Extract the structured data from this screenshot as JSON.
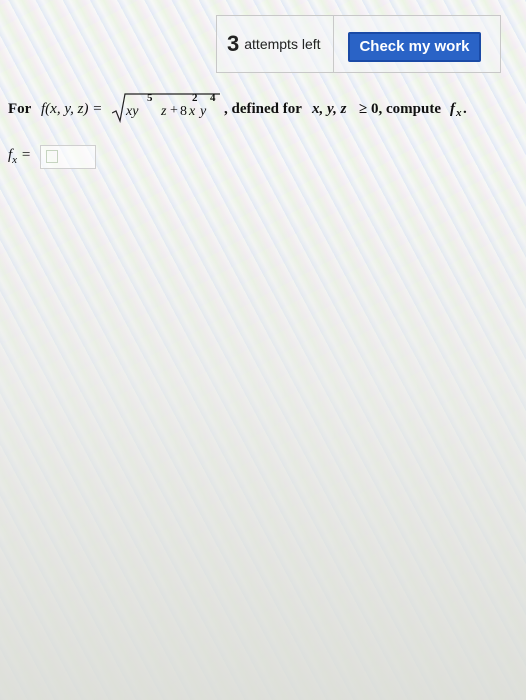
{
  "header": {
    "attempts_count": "3",
    "attempts_label": "attempts left",
    "check_button_label": "Check my work"
  },
  "problem": {
    "prefix": "For",
    "function_name": "f(x, y, z) =",
    "term1_base": "xy",
    "term1_exponent": "5",
    "term1_var": "z",
    "plus": "+",
    "coefficient": "8",
    "term2_x": "x",
    "term2_x_exponent": "2",
    "term2_y": "y",
    "term2_y_exponent": "4",
    "middle_text": ", defined for",
    "domain_vars": "x, y, z",
    "domain_condition": "≥ 0, compute",
    "target": "f",
    "target_subscript": "x",
    "end": "."
  },
  "answer": {
    "label": "f",
    "label_subscript": "x",
    "equals": "=",
    "value": ""
  },
  "colors": {
    "button_bg": "#2a63c6",
    "button_text": "#ffffff",
    "panel_border": "#c8c8c8"
  },
  "icons": {
    "answer_placeholder": "empty-square-icon"
  }
}
